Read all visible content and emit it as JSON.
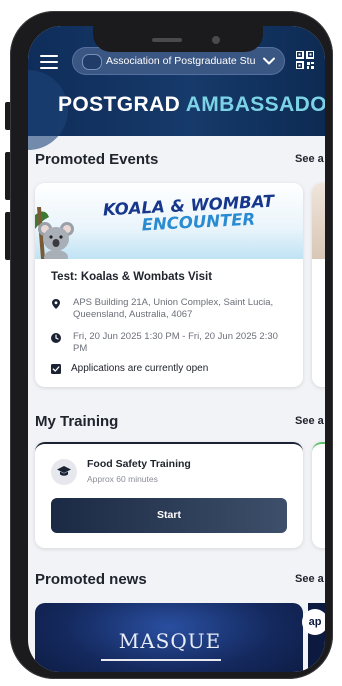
{
  "header": {
    "org_selector": "Association of Postgraduate Stu",
    "brand_part1": "POSTGRAD",
    "brand_part2": "AMBASSADOR"
  },
  "sections": {
    "events_title": "Promoted Events",
    "events_see_all": "See a",
    "training_title": "My Training",
    "training_see_all": "See a",
    "news_title": "Promoted news",
    "news_see_all": "See a"
  },
  "event": {
    "banner_line1": "KOALA & WOMBAT",
    "banner_line2": "ENCOUNTER",
    "title": "Test: Koalas & Wombats Visit",
    "location": "APS Building 21A, Union Complex, Saint Lucia, Queensland, Australia, 4067",
    "time": "Fri, 20 Jun 2025 1:30 PM - Fri, 20 Jun 2025 2:30 PM",
    "status": "Applications are currently open"
  },
  "training": {
    "name": "Food Safety Training",
    "duration": "Approx 60 minutes",
    "start_label": "Start"
  },
  "news": {
    "banner_text": "MASQUE",
    "badge": "ap"
  },
  "icons": {
    "menu": "hamburger-icon",
    "dropdown": "chevron-down-icon",
    "qr": "qr-code-icon",
    "location": "map-pin-icon",
    "time": "clock-icon",
    "status": "check-square-icon",
    "training": "graduation-cap-icon"
  },
  "colors": {
    "header_bg": "#0f2d5a",
    "brand_accent": "#7cd3e6",
    "start_button": "#1b2a44"
  }
}
